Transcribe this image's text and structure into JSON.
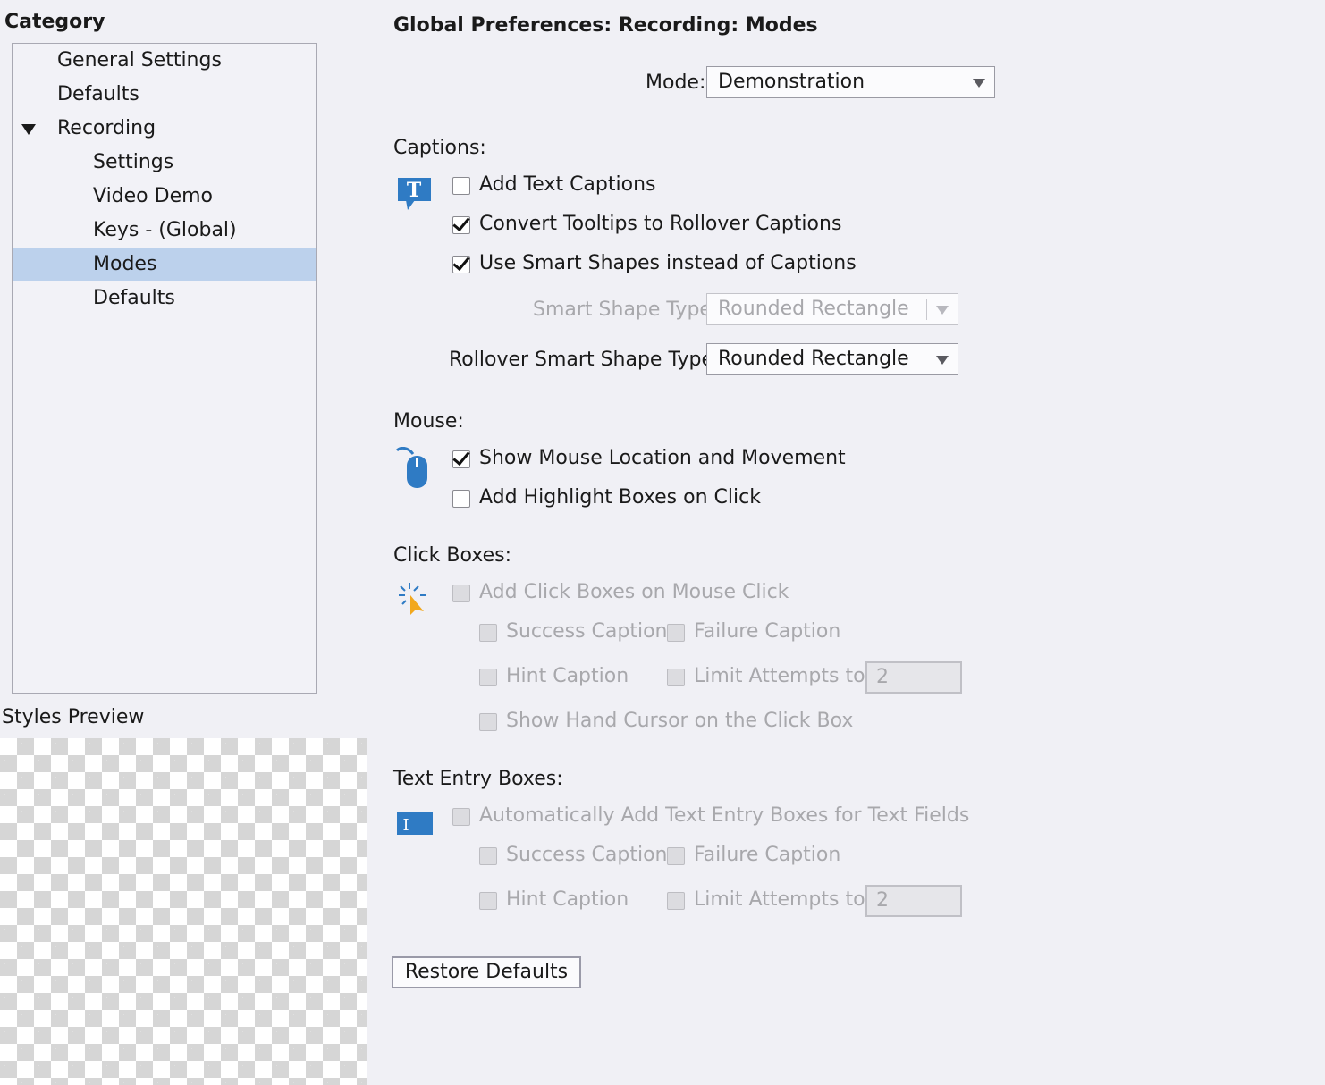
{
  "sidebar": {
    "category_heading": "Category",
    "items": [
      {
        "label": "General Settings"
      },
      {
        "label": "Defaults"
      },
      {
        "label": "Recording"
      },
      {
        "label": "Settings"
      },
      {
        "label": "Video Demo"
      },
      {
        "label": "Keys - (Global)"
      },
      {
        "label": "Modes"
      },
      {
        "label": "Defaults"
      }
    ],
    "styles_preview_heading": "Styles Preview"
  },
  "main": {
    "title": "Global Preferences: Recording: Modes",
    "mode": {
      "label": "Mode:",
      "value": "Demonstration"
    },
    "captions": {
      "heading": "Captions:",
      "add_text_captions": {
        "label": "Add Text Captions",
        "checked": false
      },
      "convert_tooltips": {
        "label": "Convert Tooltips to Rollover Captions",
        "checked": true
      },
      "use_smart_shapes": {
        "label": "Use Smart Shapes instead of Captions",
        "checked": true
      },
      "smart_shape_type": {
        "label": "Smart Shape Type",
        "value": "Rounded Rectangle",
        "enabled": false
      },
      "rollover_smart_shape_type": {
        "label": "Rollover Smart Shape Type",
        "value": "Rounded Rectangle",
        "enabled": true
      }
    },
    "mouse": {
      "heading": "Mouse:",
      "show_mouse": {
        "label": "Show Mouse Location and Movement",
        "checked": true
      },
      "highlight_boxes": {
        "label": "Add Highlight Boxes on Click",
        "checked": false
      }
    },
    "click_boxes": {
      "heading": "Click Boxes:",
      "add_click_boxes": {
        "label": "Add Click Boxes on Mouse Click",
        "checked": false
      },
      "success_caption": {
        "label": "Success Caption"
      },
      "failure_caption": {
        "label": "Failure Caption"
      },
      "hint_caption": {
        "label": "Hint Caption"
      },
      "limit_attempts": {
        "label": "Limit Attempts to",
        "value": "2"
      },
      "hand_cursor": {
        "label": "Show Hand Cursor on the Click Box"
      }
    },
    "text_entry_boxes": {
      "heading": "Text Entry Boxes:",
      "auto_add": {
        "label": "Automatically Add Text Entry Boxes for Text Fields",
        "checked": false
      },
      "success_caption": {
        "label": "Success Caption"
      },
      "failure_caption": {
        "label": "Failure Caption"
      },
      "hint_caption": {
        "label": "Hint Caption"
      },
      "limit_attempts": {
        "label": "Limit Attempts to",
        "value": "2"
      }
    },
    "restore_defaults_label": "Restore Defaults"
  },
  "colors": {
    "selection": "#bcd1ec",
    "icon_blue": "#2f7bc4",
    "click_arrow": "#f2a81d"
  }
}
